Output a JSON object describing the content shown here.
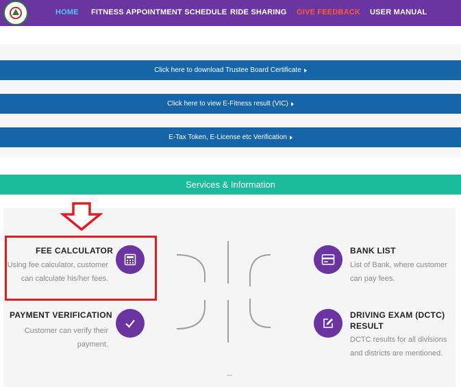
{
  "nav": {
    "items": [
      {
        "label": "HOME"
      },
      {
        "label": "FITNESS APPOINTMENT SCHEDULE"
      },
      {
        "label": "RIDE SHARING"
      },
      {
        "label": "GIVE FEEDBACK"
      },
      {
        "label": "USER MANUAL"
      }
    ],
    "home_color": "#4fc3f7",
    "feedback_color": "#ff5a36",
    "bg_color": "#6a35a0"
  },
  "links": [
    {
      "label": "Click here to download Trustee Board Certificate"
    },
    {
      "label": "Click here to view E-Fitness result (VIC)"
    },
    {
      "label": "E-Tax Token, E-License etc Verification"
    }
  ],
  "services": {
    "header": "Services & Information",
    "items": [
      {
        "title": "FEE CALCULATOR",
        "desc": "Using fee calculator, customer can calculate his/her fees.",
        "icon": "calculator-icon"
      },
      {
        "title": "PAYMENT VERIFICATION",
        "desc": "Customer can verify their payment.",
        "icon": "check-icon"
      },
      {
        "title": "BANK LIST",
        "desc": "List of Bank, where customer can pay fees.",
        "icon": "bank-card-icon"
      },
      {
        "title": "DRIVING EXAM (DCTC) RESULT",
        "desc": "DCTC results for all divisions and districts are mentioned.",
        "icon": "edit-icon"
      }
    ]
  },
  "colors": {
    "link_bar": "#1565a8",
    "services_header": "#1abc9c",
    "icon_circle": "#6a35a0",
    "highlight": "#e11d22"
  }
}
